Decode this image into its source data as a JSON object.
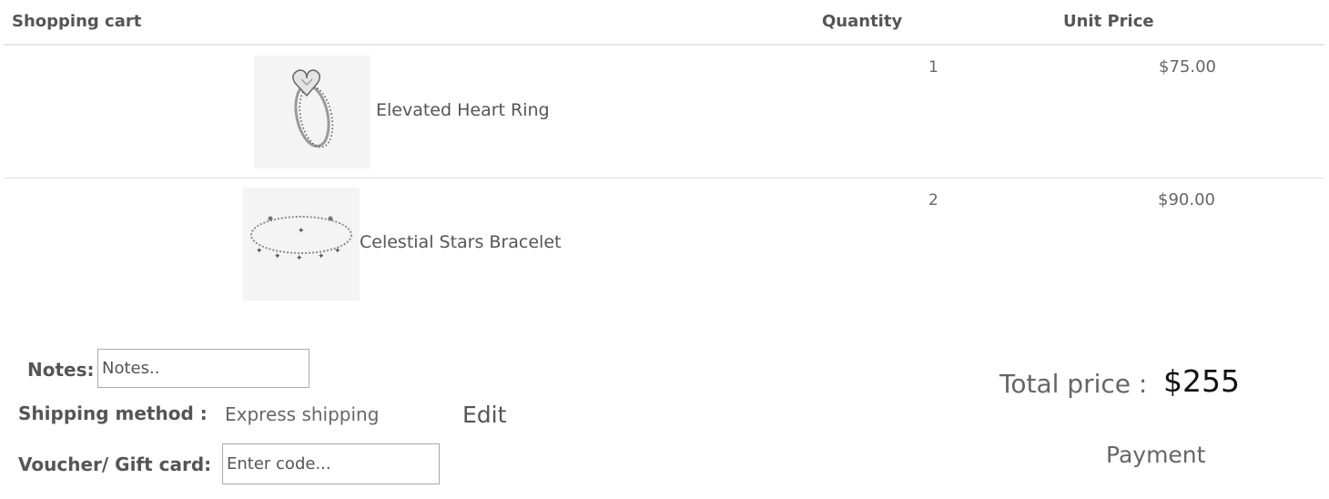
{
  "header": {
    "cart_title": "Shopping cart",
    "quantity_label": "Quantity",
    "unit_price_label": "Unit Price"
  },
  "items": [
    {
      "name": "Elevated Heart Ring",
      "quantity": "1",
      "unit_price": "$75.00",
      "image_icon": "ring-image"
    },
    {
      "name": "Celestial Stars Bracelet",
      "quantity": "2",
      "unit_price": "$90.00",
      "image_icon": "bracelet-image"
    }
  ],
  "notes": {
    "label": "Notes:",
    "placeholder": "Notes..",
    "value": ""
  },
  "shipping": {
    "label": "Shipping method :",
    "value": "Express shipping",
    "edit_label": "Edit"
  },
  "voucher": {
    "label": "Voucher/ Gift card:",
    "placeholder": "Enter code...",
    "value": ""
  },
  "total": {
    "label": "Total price : ",
    "value": "$255"
  },
  "payment": {
    "label": "Payment"
  }
}
